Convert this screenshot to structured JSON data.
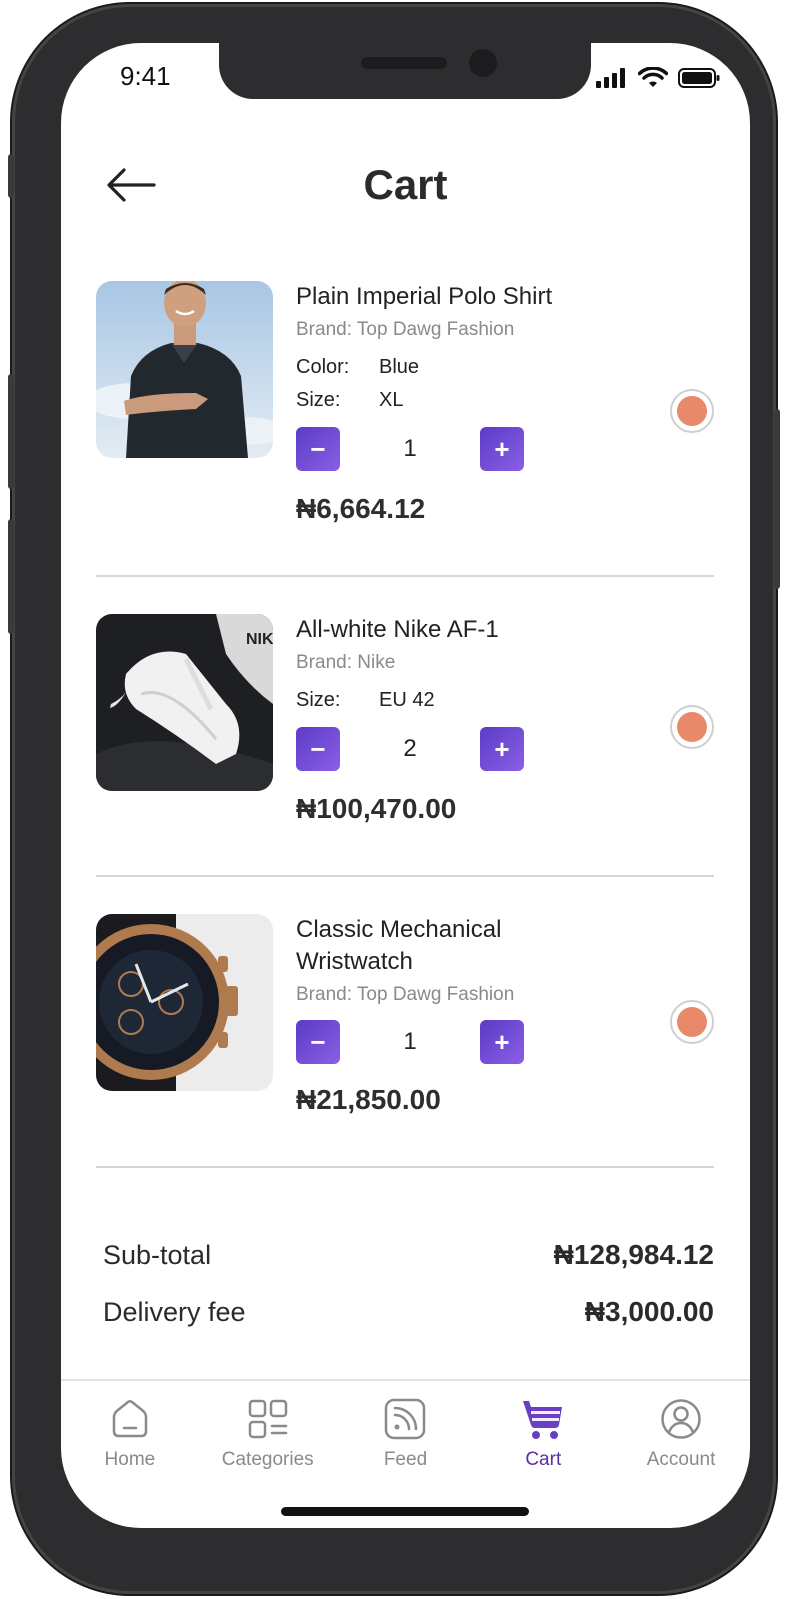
{
  "status_bar": {
    "time": "9:41"
  },
  "header": {
    "title": "Cart"
  },
  "cart_items": [
    {
      "name": "Plain Imperial Polo Shirt",
      "brand": "Brand: Top Dawg Fashion",
      "color_label": "Color:",
      "color_value": "Blue",
      "size_label": "Size:",
      "size_value": "XL",
      "quantity": "1",
      "price": "₦6,664.12"
    },
    {
      "name": "All-white Nike AF-1",
      "brand": "Brand: Nike",
      "size_label": "Size:",
      "size_value": "EU 42",
      "quantity": "2",
      "price": "₦100,470.00"
    },
    {
      "name_line1": "Classic Mechanical",
      "name_line2": "Wristwatch",
      "brand": "Brand: Top Dawg Fashion",
      "quantity": "1",
      "price": "₦21,850.00"
    }
  ],
  "qty_controls": {
    "minus": "−",
    "plus": "+"
  },
  "summary": {
    "subtotal_label": "Sub-total",
    "subtotal_value": "₦128,984.12",
    "delivery_label": "Delivery fee",
    "delivery_value": "₦3,000.00"
  },
  "tab_bar": {
    "active": "Cart",
    "accent_color": "#5b2ea6",
    "tabs": [
      {
        "label": "Home",
        "icon": "home-icon"
      },
      {
        "label": "Categories",
        "icon": "categories-icon"
      },
      {
        "label": "Feed",
        "icon": "feed-icon"
      },
      {
        "label": "Cart",
        "icon": "cart-icon"
      },
      {
        "label": "Account",
        "icon": "account-icon"
      }
    ]
  },
  "colors": {
    "qty_button": "#6a45d4",
    "selection_dot": "#e8896a"
  }
}
